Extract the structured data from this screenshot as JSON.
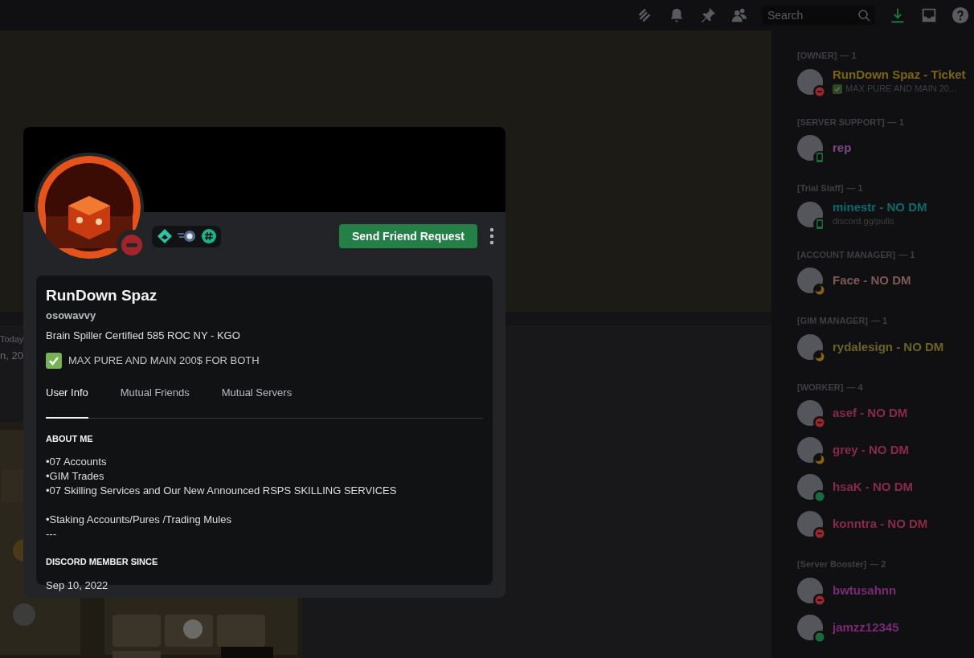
{
  "top_bar": {
    "search": {
      "placeholder": "Search"
    }
  },
  "chat": {
    "day_label": "Today",
    "message_fragment": "n, 20"
  },
  "profile": {
    "status": {
      "kind": "dnd"
    },
    "action_button": "Send Friend Request",
    "display_name": "RunDown Spaz",
    "username": "osowavvy",
    "bio": "Brain Spiller Certified 585 ROC NY - KGO",
    "custom_status": "MAX PURE AND MAIN 200$ FOR BOTH",
    "tabs": [
      {
        "label": "User Info",
        "selected": true
      },
      {
        "label": "Mutual Friends",
        "selected": false
      },
      {
        "label": "Mutual Servers",
        "selected": false
      }
    ],
    "sections": [
      {
        "heading": "ABOUT ME",
        "paragraphs": [
          [
            "•07 Accounts",
            "•GIM Trades",
            "•07 Skilling Services and Our New Announced RSPS SKILLING SERVICES"
          ],
          [
            "•Staking Accounts/Pures /Trading Mules",
            "---"
          ]
        ]
      },
      {
        "heading": "DISCORD MEMBER SINCE",
        "paragraphs": [
          [
            "Sep 10, 2022"
          ]
        ]
      }
    ]
  },
  "member_list": [
    {
      "role": "[OWNER]",
      "count": "— 1",
      "members": [
        {
          "name": "RunDown Spaz - Ticket",
          "color": "#7a650e",
          "kind": "dnd",
          "activity": "MAX PURE AND MAIN 20..."
        }
      ]
    },
    {
      "role": "[SERVER SUPPORT]",
      "count": "— 1",
      "members": [
        {
          "name": "rep",
          "color": "#7a4a80",
          "kind": "mobile"
        }
      ]
    },
    {
      "role": "[Trial Staff]",
      "count": "— 1",
      "members": [
        {
          "name": "minestr - NO DM",
          "color": "#0b6a6a",
          "kind": "mobile",
          "activity": "discord.gg/pulls"
        }
      ]
    },
    {
      "role": "[ACCOUNT MANAGER]",
      "count": "— 1",
      "members": [
        {
          "name": "Face - NO DM",
          "color": "#7d5a55",
          "kind": "idle"
        }
      ]
    },
    {
      "role": "[GIM MANAGER]",
      "count": "— 1",
      "members": [
        {
          "name": "rydalesign - NO DM",
          "color": "#6a6424",
          "kind": "idle"
        }
      ]
    },
    {
      "role": "[WORKER]",
      "count": "— 4",
      "members": [
        {
          "name": "asef - NO DM",
          "color": "#8a2a48",
          "kind": "dnd"
        },
        {
          "name": "grey - NO DM",
          "color": "#8a2a48",
          "kind": "idle"
        },
        {
          "name": "hsaK - NO DM",
          "color": "#8a2a48",
          "kind": "online"
        },
        {
          "name": "konntra - NO DM",
          "color": "#8a2a48",
          "kind": "dnd"
        }
      ]
    },
    {
      "role": "[Server Booster]",
      "count": "— 2",
      "members": [
        {
          "name": "bwtusahnn",
          "color": "#7a2a76",
          "kind": "dnd"
        },
        {
          "name": "jamzz12345",
          "color": "#7a2a76",
          "kind": "online"
        }
      ]
    }
  ]
}
